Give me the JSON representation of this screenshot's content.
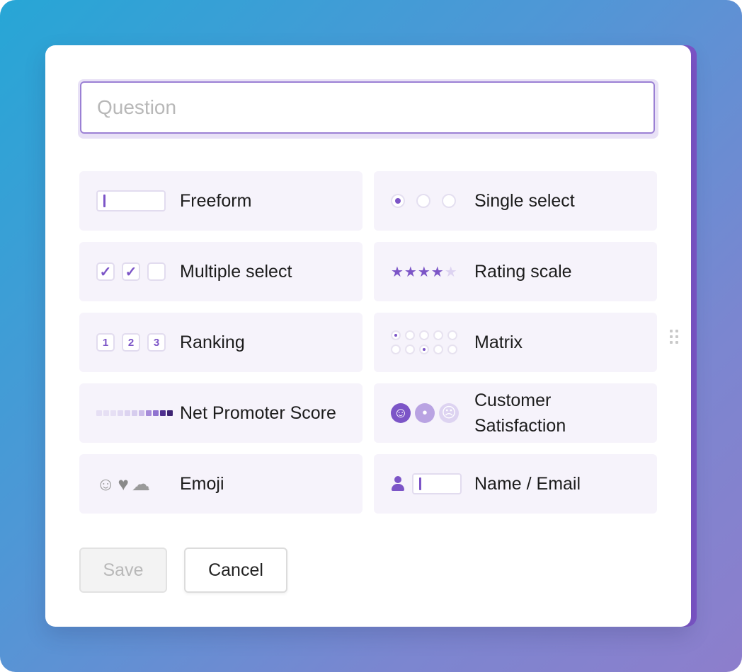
{
  "question": {
    "placeholder": "Question"
  },
  "options": [
    {
      "id": "freeform",
      "label": "Freeform",
      "icon": "text-input-icon"
    },
    {
      "id": "single-select",
      "label": "Single select",
      "icon": "radio-buttons-icon"
    },
    {
      "id": "multiple-select",
      "label": "Multiple select",
      "icon": "checkboxes-icon"
    },
    {
      "id": "rating-scale",
      "label": "Rating scale",
      "icon": "stars-icon",
      "stars_filled": 4,
      "stars_total": 5
    },
    {
      "id": "ranking",
      "label": "Ranking",
      "icon": "ranking-icon",
      "ranks": [
        "1",
        "2",
        "3"
      ]
    },
    {
      "id": "matrix",
      "label": "Matrix",
      "icon": "matrix-icon"
    },
    {
      "id": "nps",
      "label": "Net Promoter Score",
      "icon": "nps-scale-icon"
    },
    {
      "id": "csat",
      "label": "Customer Satisfaction",
      "label_line1": "Customer",
      "label_line2": "Satisfaction",
      "icon": "faces-icon"
    },
    {
      "id": "emoji",
      "label": "Emoji",
      "icon": "emoji-icon"
    },
    {
      "id": "name-email",
      "label": "Name / Email",
      "icon": "person-input-icon"
    }
  ],
  "buttons": {
    "save": "Save",
    "cancel": "Cancel"
  },
  "colors": {
    "accent": "#7c55c7",
    "tile_bg": "#f6f3fb",
    "bg_start": "#27a6d6",
    "bg_end": "#8d7ecc"
  }
}
